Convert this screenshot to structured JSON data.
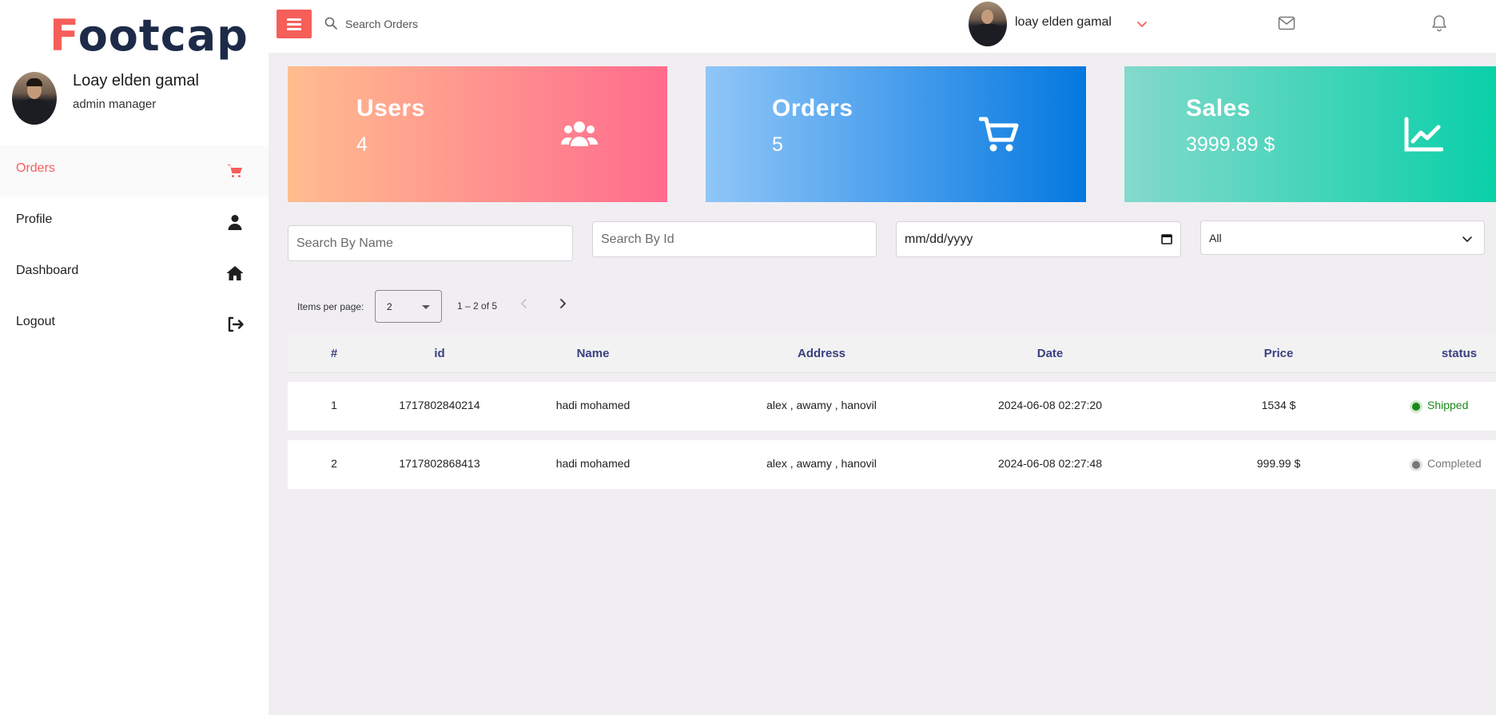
{
  "brand": {
    "logo_first": "F",
    "logo_rest": "ootcap",
    "accent": "#f65e5a"
  },
  "profile": {
    "name": "Loay elden gamal",
    "role": "admin manager"
  },
  "sidebar": {
    "items": [
      {
        "label": "Orders",
        "icon": "cart-icon",
        "active": true
      },
      {
        "label": "Profile",
        "icon": "user-icon"
      },
      {
        "label": "Dashboard",
        "icon": "home-icon"
      },
      {
        "label": "Logout",
        "icon": "logout-icon"
      }
    ]
  },
  "topbar": {
    "search_placeholder": "Search Orders",
    "username": "loay elden gamal"
  },
  "stats": {
    "users": {
      "title": "Users",
      "value": "4",
      "icon": "users-icon"
    },
    "orders": {
      "title": "Orders",
      "value": "5",
      "icon": "cart-icon"
    },
    "sales": {
      "title": "Sales",
      "value": "3999.89 $",
      "icon": "chart-line-icon"
    }
  },
  "filters": {
    "name_placeholder": "Search By Name",
    "id_placeholder": "Search By Id",
    "date_placeholder": "mm/dd/yyyy",
    "status_selected": "All"
  },
  "paginator": {
    "label": "Items per page:",
    "page_size": "2",
    "range": "1 – 2 of 5"
  },
  "table": {
    "headers": [
      "#",
      "id",
      "Name",
      "Address",
      "Date",
      "Price",
      "status"
    ],
    "rows": [
      {
        "num": "1",
        "id": "1717802840214",
        "name": "hadi mohamed",
        "address": "alex , awamy , hanovil",
        "date": "2024-06-08 02:27:20",
        "price": "1534 $",
        "status": "Shipped",
        "status_color": "#1a8a1a"
      },
      {
        "num": "2",
        "id": "1717802868413",
        "name": "hadi mohamed",
        "address": "alex , awamy , hanovil",
        "date": "2024-06-08 02:27:48",
        "price": "999.99 $",
        "status": "Completed",
        "status_color": "#777777"
      }
    ]
  }
}
